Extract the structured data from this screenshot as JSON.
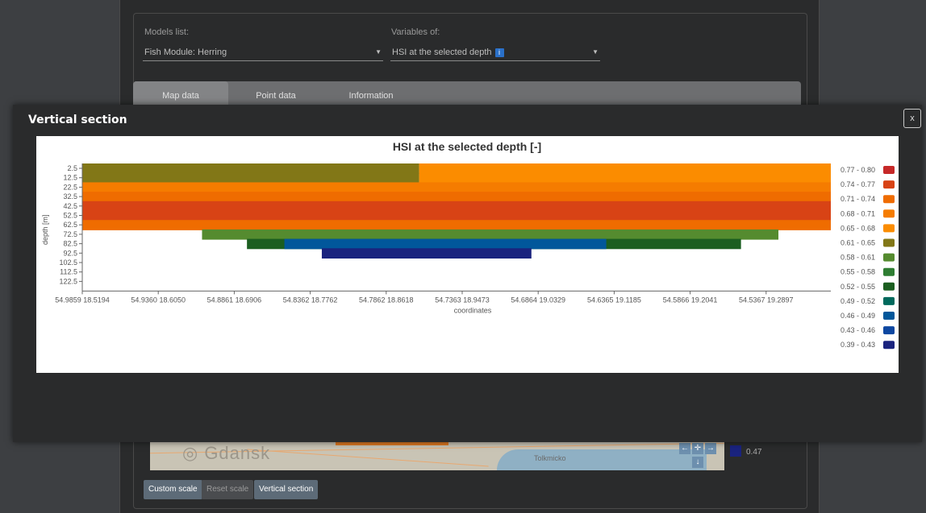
{
  "app": {
    "models_label": "Models list:",
    "model_value": "Fish Module: Herring",
    "variables_label": "Variables of:",
    "variable_value": "HSI at the selected depth",
    "info_icon": "i",
    "tabs": [
      {
        "label": "Map data",
        "active": true
      },
      {
        "label": "Point data",
        "active": false
      },
      {
        "label": "Information",
        "active": false
      }
    ],
    "map_bg_legend_value": "0.47",
    "map_town": "Tolkmicko",
    "map_logo_text": "Gdansk",
    "buttons": {
      "custom_scale": "Custom scale",
      "reset_scale": "Reset scale",
      "vertical_section": "Vertical section"
    },
    "nav_icons": [
      "arrow-left-icon",
      "crosshair-icon",
      "arrow-right-icon",
      "arrow-down-icon"
    ]
  },
  "modal": {
    "title": "Vertical section",
    "close_label": "x"
  },
  "chart_data": {
    "type": "heatmap",
    "title": "HSI at the selected depth [-]",
    "xlabel": "coordinates",
    "ylabel": "depth [m]",
    "y_ticks": [
      "2.5",
      "12.5",
      "22.5",
      "32.5",
      "42.5",
      "52.5",
      "62.5",
      "72.5",
      "82.5",
      "92.5",
      "102.5",
      "112.5",
      "122.5"
    ],
    "x_ticks": [
      "54.9859 18.5194",
      "54.9360 18.6050",
      "54.8861 18.6906",
      "54.8362 18.7762",
      "54.7862 18.8618",
      "54.7363 18.9473",
      "54.6864 19.0329",
      "54.6365 19.1185",
      "54.5866 19.2041",
      "54.5367 19.2897"
    ],
    "legend": [
      {
        "label": "0.77 - 0.80",
        "color": "#c62828"
      },
      {
        "label": "0.74 - 0.77",
        "color": "#d84315"
      },
      {
        "label": "0.71 - 0.74",
        "color": "#ef6c00"
      },
      {
        "label": "0.68 - 0.71",
        "color": "#f57c00"
      },
      {
        "label": "0.65 - 0.68",
        "color": "#fb8c00"
      },
      {
        "label": "0.61 - 0.65",
        "color": "#827717"
      },
      {
        "label": "0.58 - 0.61",
        "color": "#558b2f"
      },
      {
        "label": "0.55 - 0.58",
        "color": "#2e7d32"
      },
      {
        "label": "0.52 - 0.55",
        "color": "#1b5e20"
      },
      {
        "label": "0.49 - 0.52",
        "color": "#00695c"
      },
      {
        "label": "0.46 - 0.49",
        "color": "#01579b"
      },
      {
        "label": "0.43 - 0.46",
        "color": "#0d47a1"
      },
      {
        "label": "0.39 - 0.43",
        "color": "#1a237e"
      }
    ],
    "bands": [
      {
        "depth": "2.5",
        "class": "0.61 - 0.65",
        "x_from": 0.0,
        "x_to": 0.45
      },
      {
        "depth": "2.5",
        "class": "0.65 - 0.68",
        "x_from": 0.45,
        "x_to": 1.0
      },
      {
        "depth": "12.5",
        "class": "0.61 - 0.65",
        "x_from": 0.0,
        "x_to": 0.45
      },
      {
        "depth": "12.5",
        "class": "0.65 - 0.68",
        "x_from": 0.45,
        "x_to": 1.0
      },
      {
        "depth": "22.5",
        "class": "0.68 - 0.71",
        "x_from": 0.0,
        "x_to": 1.0
      },
      {
        "depth": "32.5",
        "class": "0.71 - 0.74",
        "x_from": 0.0,
        "x_to": 1.0
      },
      {
        "depth": "42.5",
        "class": "0.74 - 0.77",
        "x_from": 0.0,
        "x_to": 1.0
      },
      {
        "depth": "52.5",
        "class": "0.74 - 0.77",
        "x_from": 0.0,
        "x_to": 1.0
      },
      {
        "depth": "62.5",
        "class": "0.71 - 0.74",
        "x_from": 0.0,
        "x_to": 1.0
      },
      {
        "depth": "72.5",
        "class": "0.58 - 0.61",
        "x_from": 0.16,
        "x_to": 0.93
      },
      {
        "depth": "82.5",
        "class": "0.52 - 0.55",
        "x_from": 0.22,
        "x_to": 0.88
      },
      {
        "depth": "82.5",
        "class": "0.46 - 0.49",
        "x_from": 0.27,
        "x_to": 0.7
      },
      {
        "depth": "92.5",
        "class": "0.39 - 0.43",
        "x_from": 0.32,
        "x_to": 0.6
      }
    ]
  }
}
